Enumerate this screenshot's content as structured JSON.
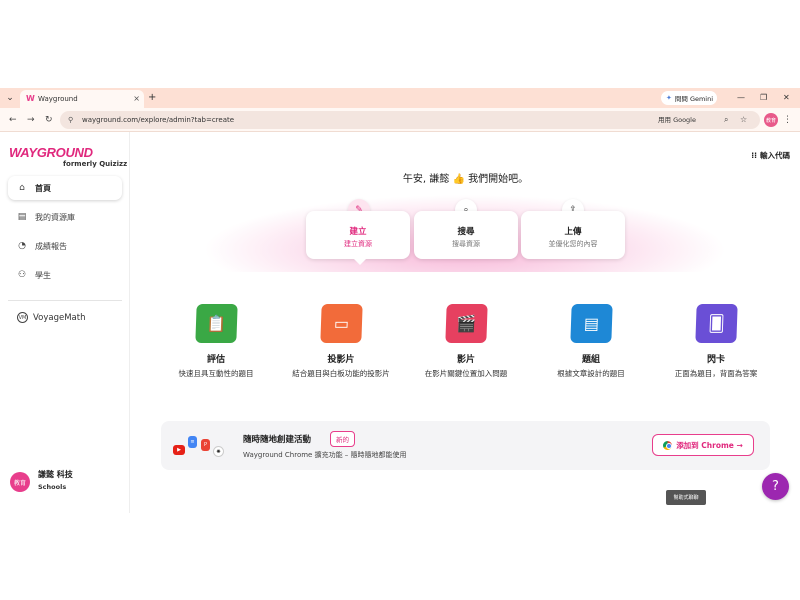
{
  "browser": {
    "tab_title": "Wayground",
    "tab_close": "×",
    "new_tab": "+",
    "gemini_label": "問問 Gemini",
    "minimize": "—",
    "restore": "❐",
    "close": "✕",
    "url": "wayground.com/explore/admin?tab=create",
    "translate_label": "用用 Google",
    "profile_initials": "教育"
  },
  "sidebar": {
    "logo_text": "WAYGROUND",
    "logo_sub": "formerly Quizizz",
    "items": [
      {
        "label": "首頁",
        "icon": "home-icon",
        "active": true
      },
      {
        "label": "我的資源庫",
        "icon": "library-icon",
        "active": false
      },
      {
        "label": "成績報告",
        "icon": "report-icon",
        "active": false
      },
      {
        "label": "學生",
        "icon": "students-icon",
        "active": false
      }
    ],
    "voyage_label": "VoyageMath",
    "user": {
      "initials": "教育",
      "name": "謙懿 科技",
      "school": "Schools"
    }
  },
  "main": {
    "enter_code": "輸入代碼",
    "greeting": "午安, 謙懿 👍 我們開始吧。",
    "actions": [
      {
        "label": "建立",
        "sub": "建立資源",
        "icon": "pencil-icon",
        "active": true
      },
      {
        "label": "搜尋",
        "sub": "搜尋資源",
        "icon": "search-icon",
        "active": false
      },
      {
        "label": "上傳",
        "sub": "並優化您的內容",
        "icon": "upload-icon",
        "active": false
      }
    ],
    "types": [
      {
        "name": "評估",
        "desc": "快速且具互動性的題目",
        "color": "#3aa845",
        "icon": "assessment-icon"
      },
      {
        "name": "投影片",
        "desc": "結合題目與白板功能的投影片",
        "color": "#f26b3a",
        "icon": "slides-icon"
      },
      {
        "name": "影片",
        "desc": "在影片關鍵位置加入問題",
        "color": "#e64060",
        "icon": "video-icon"
      },
      {
        "name": "題組",
        "desc": "根據文章設計的題目",
        "color": "#1e88d6",
        "icon": "passage-icon"
      },
      {
        "name": "閃卡",
        "desc": "正面為題目，背面為答案",
        "color": "#6a4fd6",
        "icon": "flashcard-icon"
      }
    ],
    "banner": {
      "title": "隨時隨地創建活動",
      "badge": "新的",
      "desc": "Wayground Chrome 擴充功能 – 隨時隨地都能使用",
      "cta": "添加到 Chrome →"
    },
    "tooltip": "幫助式聊聊",
    "help": "?"
  }
}
